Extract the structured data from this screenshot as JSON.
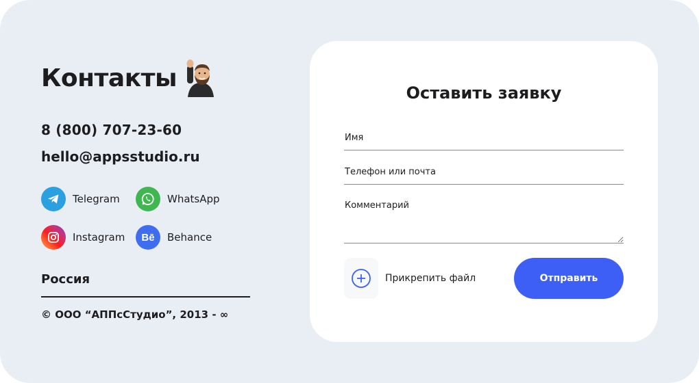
{
  "contacts": {
    "title": "Контакты",
    "phone": "8 (800) 707-23-60",
    "email": "hello@appsstudio.ru",
    "socials": [
      {
        "label": "Telegram",
        "icon": "telegram-icon",
        "color": "#2aa0e1"
      },
      {
        "label": "WhatsApp",
        "icon": "whatsapp-icon",
        "color": "#3fb650"
      },
      {
        "label": "Instagram",
        "icon": "instagram-icon",
        "color": "#e1306c"
      },
      {
        "label": "Behance",
        "icon": "behance-icon",
        "color": "#3f6df0",
        "glyph": "Bē"
      }
    ],
    "country": "Россия",
    "copyright": "© ООО “АППсСтудио”, 2013 - ∞"
  },
  "form": {
    "title": "Оставить заявку",
    "name_placeholder": "Имя",
    "contact_placeholder": "Телефон или почта",
    "comment_placeholder": "Комментарий",
    "attach_label": "Прикрепить файл",
    "submit_label": "Отправить"
  },
  "colors": {
    "background": "#e9eef5",
    "card": "#ffffff",
    "accent": "#3e5ff5",
    "text": "#1d1d1f"
  }
}
